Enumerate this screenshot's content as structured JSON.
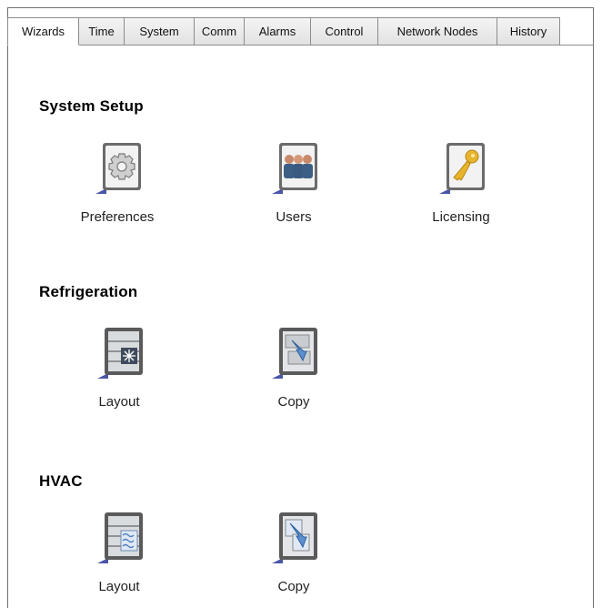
{
  "tabs": [
    {
      "label": "Wizards",
      "active": true
    },
    {
      "label": "Time"
    },
    {
      "label": "System"
    },
    {
      "label": "Comm"
    },
    {
      "label": "Alarms"
    },
    {
      "label": "Control"
    },
    {
      "label": "Network Nodes"
    },
    {
      "label": "History"
    }
  ],
  "sections": {
    "system_setup": {
      "title": "System Setup",
      "items": [
        {
          "label": "Preferences",
          "icon": "gear-icon"
        },
        {
          "label": "Users",
          "icon": "users-icon"
        },
        {
          "label": "Licensing",
          "icon": "key-icon"
        }
      ]
    },
    "refrigeration": {
      "title": "Refrigeration",
      "items": [
        {
          "label": "Layout",
          "icon": "refrigeration-layout-icon"
        },
        {
          "label": "Copy",
          "icon": "copy-icon"
        }
      ]
    },
    "hvac": {
      "title": "HVAC",
      "items": [
        {
          "label": "Layout",
          "icon": "hvac-layout-icon"
        },
        {
          "label": "Copy",
          "icon": "copy-icon"
        }
      ]
    }
  },
  "colors": {
    "tab_border": "#8c8c8c",
    "icon_frame": "#5e5e5e",
    "key_gold": "#e7b52c",
    "users_blue": "#3d5f86",
    "arrow_blue": "#5b8fd0"
  }
}
